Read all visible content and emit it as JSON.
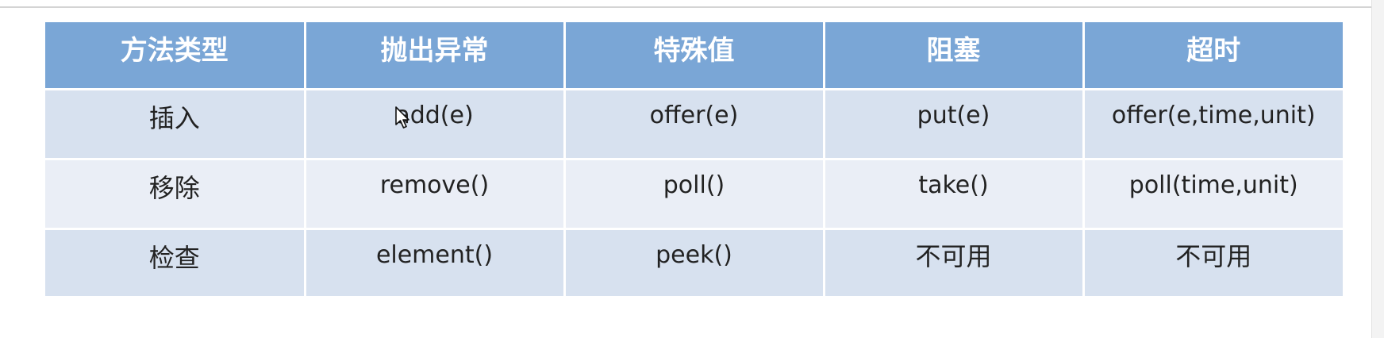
{
  "table": {
    "headers": [
      "方法类型",
      "抛出异常",
      "特殊值",
      "阻塞",
      "超时"
    ],
    "rows": [
      {
        "type": "插入",
        "throws": "add(e)",
        "special": "offer(e)",
        "blocks": "put(e)",
        "timeout": "offer(e,time,unit)"
      },
      {
        "type": "移除",
        "throws": "remove()",
        "special": "poll()",
        "blocks": "take()",
        "timeout": "poll(time,unit)"
      },
      {
        "type": "检查",
        "throws": "element()",
        "special": "peek()",
        "blocks": "不可用",
        "timeout": "不可用"
      }
    ]
  },
  "colors": {
    "header_bg": "#7aa6d6",
    "row_dark": "#d7e1ef",
    "row_light": "#eaeef6"
  },
  "icons": {
    "cursor": "mouse-pointer-icon"
  }
}
